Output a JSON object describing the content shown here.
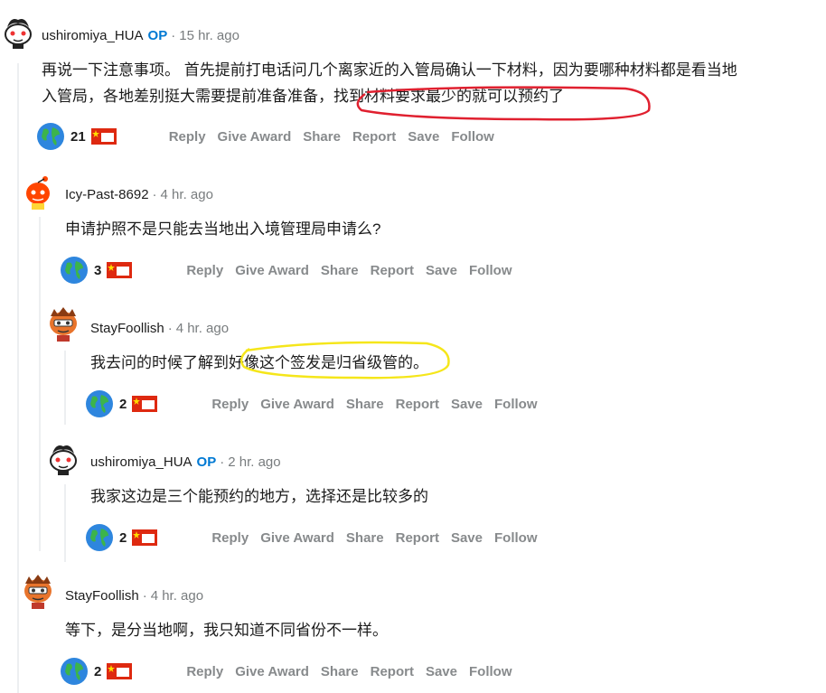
{
  "colors": {
    "op_badge": "#0079d3",
    "action_text": "#878a8c",
    "meta_gray": "#787c7e",
    "thread_line": "#edeff1",
    "annotation_red": "#e0202f",
    "annotation_yellow": "#f5e61a"
  },
  "actions": [
    "Reply",
    "Give Award",
    "Share",
    "Report",
    "Save",
    "Follow"
  ],
  "comments": [
    {
      "author": "ushiromiya_HUA",
      "op": "OP",
      "sep": "·",
      "time": "15 hr. ago",
      "text1": "再说一下注意事项。 首先提前打电话问几个离家近的入管局确认一下材料，因为要哪种材料都是看当地",
      "text2": "入管局，各地差别挺大需要提前准备准备，找到材料要求最少的就可以预约了",
      "score": "21",
      "icons": [
        "globe-award-icon",
        "china-flag-icon"
      ]
    },
    {
      "author": "Icy-Past-8692",
      "sep": "·",
      "time": "4 hr. ago",
      "text1": "申请护照不是只能去当地出入境管理局申请么?",
      "score": "3",
      "icons": [
        "globe-award-icon",
        "china-flag-icon"
      ]
    },
    {
      "author": "StayFoollish",
      "sep": "·",
      "time": "4 hr. ago",
      "text1": "我去问的时候了解到好像这个签发是归省级管的。",
      "score": "2",
      "icons": [
        "globe-award-icon",
        "china-flag-icon"
      ]
    },
    {
      "author": "ushiromiya_HUA",
      "op": "OP",
      "sep": "·",
      "time": "2 hr. ago",
      "text1": "我家这边是三个能预约的地方，选择还是比较多的",
      "score": "2",
      "icons": [
        "globe-award-icon",
        "china-flag-icon"
      ]
    },
    {
      "author": "StayFoollish",
      "sep": "·",
      "time": "4 hr. ago",
      "text1": "等下，是分当地啊，我只知道不同省份不一样。",
      "score": "2",
      "icons": [
        "globe-award-icon",
        "china-flag-icon"
      ]
    }
  ]
}
